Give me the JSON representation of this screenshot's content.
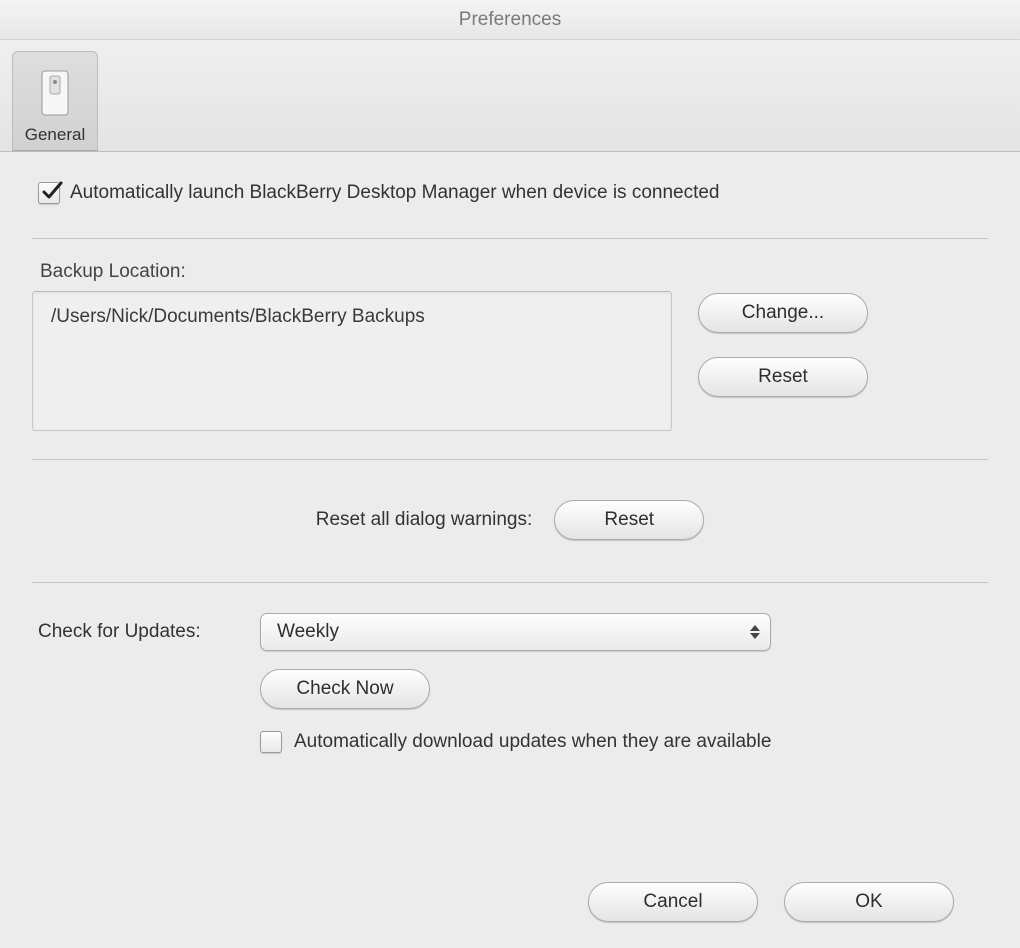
{
  "window": {
    "title": "Preferences"
  },
  "toolbar": {
    "items": [
      {
        "label": "General",
        "icon": "switch-icon"
      }
    ]
  },
  "general": {
    "auto_launch": {
      "checked": true,
      "label": "Automatically launch BlackBerry Desktop Manager when device is connected"
    },
    "backup": {
      "label": "Backup Location:",
      "path": "/Users/Nick/Documents/BlackBerry Backups",
      "change_label": "Change...",
      "reset_label": "Reset"
    },
    "reset_warnings": {
      "label": "Reset all dialog warnings:",
      "button": "Reset"
    },
    "updates": {
      "label": "Check for Updates:",
      "frequency": "Weekly",
      "check_now": "Check Now",
      "auto_download": {
        "checked": false,
        "label": "Automatically download updates when they are available"
      }
    }
  },
  "footer": {
    "cancel": "Cancel",
    "ok": "OK"
  }
}
